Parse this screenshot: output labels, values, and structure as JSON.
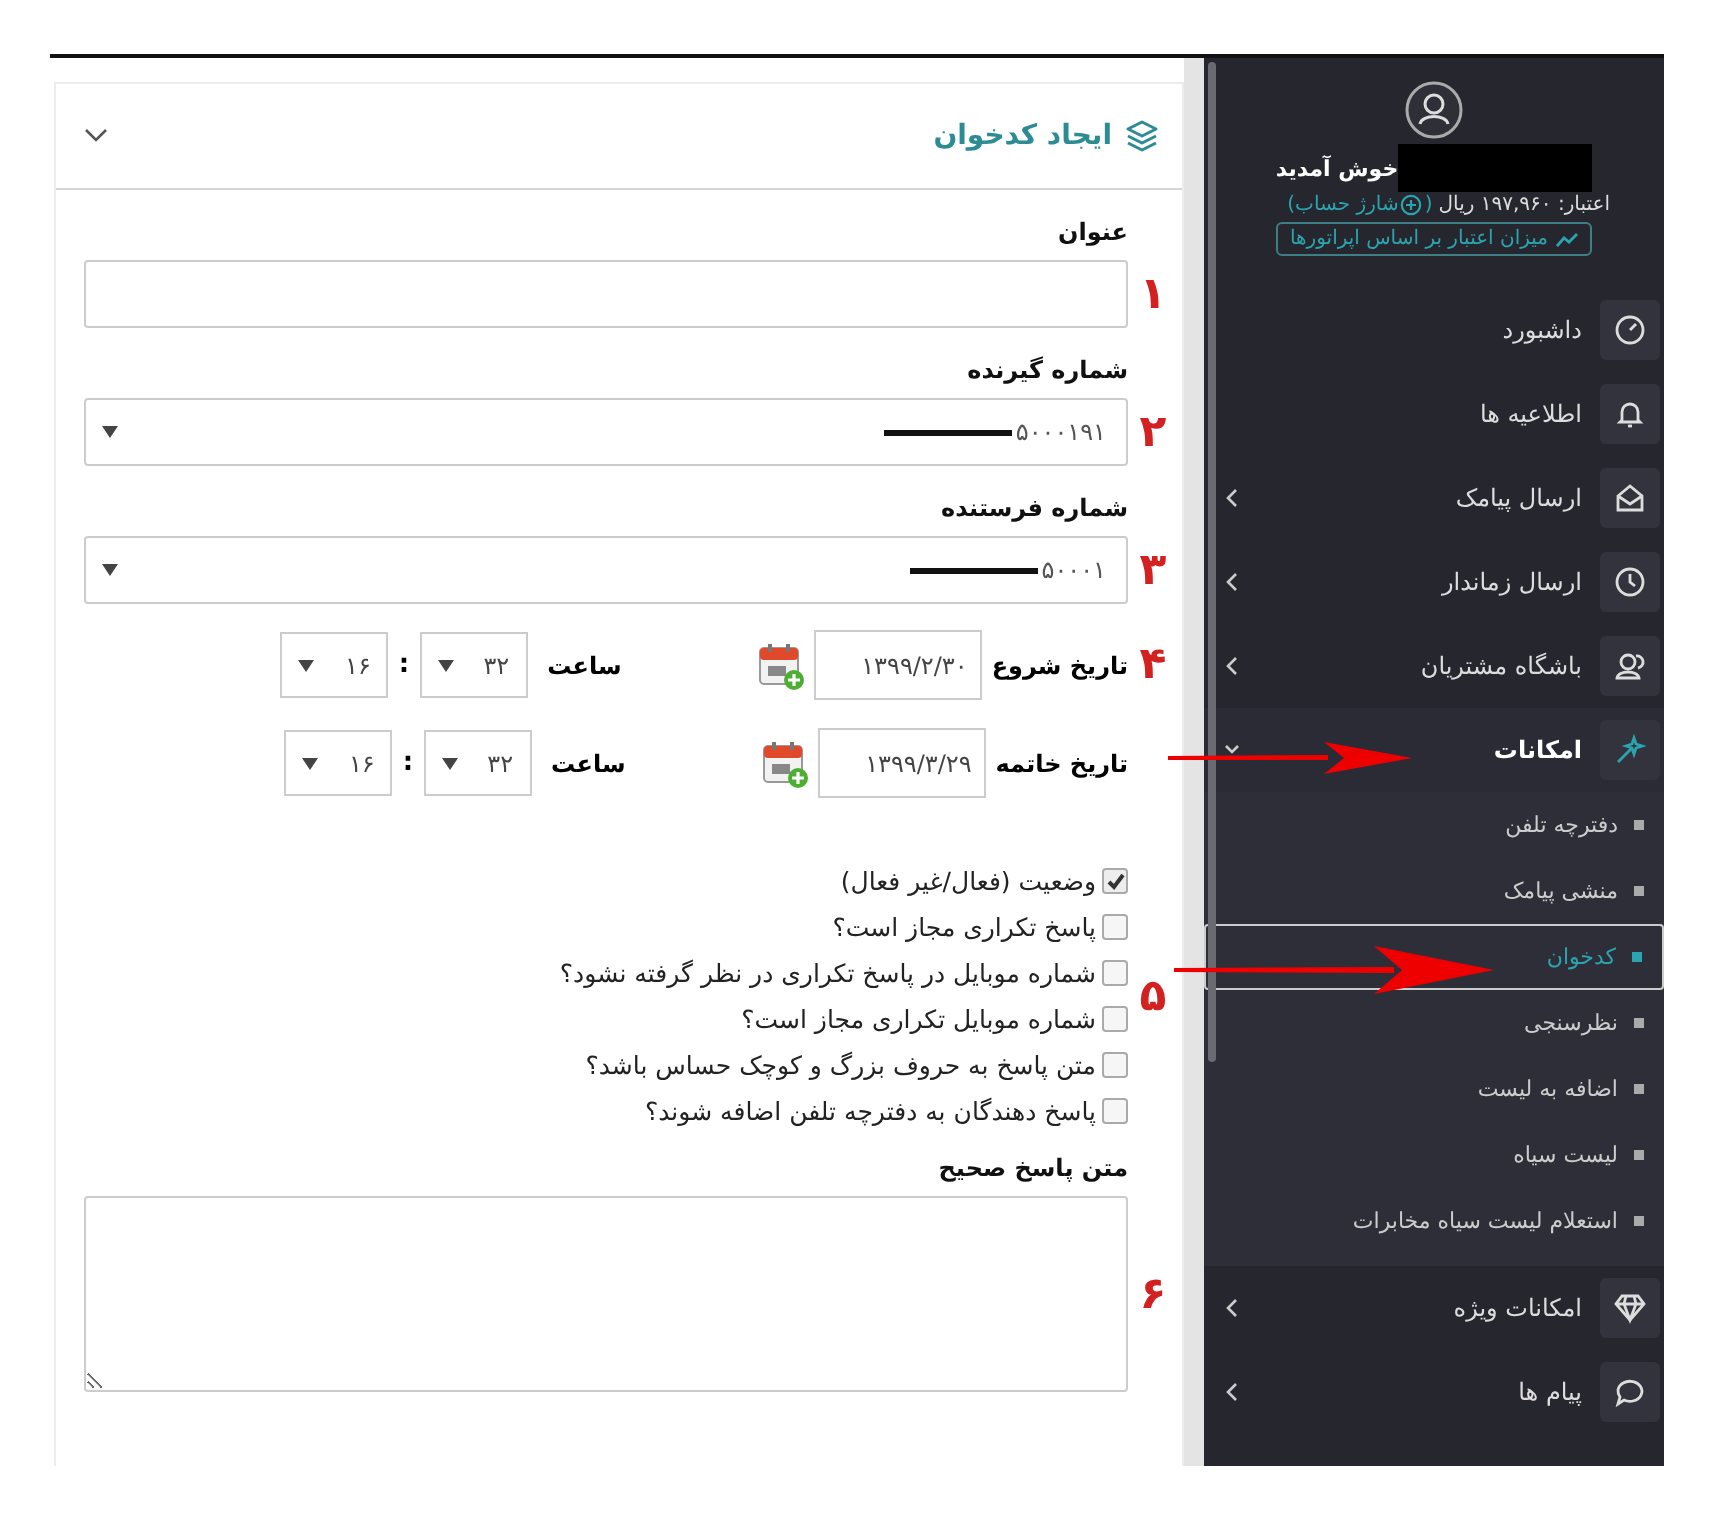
{
  "card": {
    "title": "ایجاد کدخوان"
  },
  "fields": [
    {
      "kind": "text",
      "label": "عنوان",
      "marker": "۱"
    },
    {
      "kind": "select",
      "label": "شماره گیرنده",
      "value": "۵۰۰۰۱۹۱",
      "marker": "۲"
    },
    {
      "kind": "select",
      "label": "شماره فرستنده",
      "value": "۵۰۰۰۱",
      "marker": "۳"
    }
  ],
  "dates": [
    {
      "label": "تاریخ شروع",
      "value": "۱۳۹۹/۲/۳۰",
      "time_label": "ساعت",
      "time_1": "۳۲",
      "separator": ":",
      "time_2": "۱۶",
      "marker": "۴"
    },
    {
      "label": "تاریخ خاتمه",
      "value": "۱۳۹۹/۳/۲۹",
      "time_label": "ساعت",
      "time_1": "۳۲",
      "separator": ":",
      "time_2": "۱۶"
    }
  ],
  "options": {
    "marker": "۵",
    "items": [
      {
        "label": "وضعیت (فعال/غیر فعال)",
        "checked": true
      },
      {
        "label": "پاسخ تکراری مجاز است؟",
        "checked": false
      },
      {
        "label": "شماره موبایل در پاسخ تکراری در نظر گرفته نشود؟",
        "checked": false
      },
      {
        "label": "شماره موبایل تکراری مجاز است؟",
        "checked": false
      },
      {
        "label": "متن پاسخ به حروف بزرگ و کوچک حساس باشد؟",
        "checked": false
      },
      {
        "label": "پاسخ دهندگان به دفترچه تلفن اضافه شوند؟",
        "checked": false
      }
    ]
  },
  "answer": {
    "label": "متن پاسخ صحیح",
    "marker": "۶"
  },
  "sidebar": {
    "welcome": "خوش آمدید",
    "credit": "اعتبار: ۱۹۷,۹۶۰ ریال",
    "charge_link": {
      "prefix": "(",
      "label": "شارژ حساب)"
    },
    "operator_button": "میزان اعتبار بر اساس اپراتورها",
    "menu": [
      {
        "label": "داشبورد",
        "has_children": false,
        "expanded": false
      },
      {
        "label": "اطلاعیه ها",
        "has_children": false,
        "expanded": false
      },
      {
        "label": "ارسال پیامک",
        "has_children": true,
        "expanded": false
      },
      {
        "label": "ارسال زماندار",
        "has_children": true,
        "expanded": false
      },
      {
        "label": "باشگاه مشتریان",
        "has_children": true,
        "expanded": false
      },
      {
        "label": "امکانات",
        "has_children": true,
        "expanded": true,
        "children": [
          {
            "label": "دفترچه تلفن",
            "selected": false
          },
          {
            "label": "منشی پیامک",
            "selected": false
          },
          {
            "label": "کدخوان",
            "selected": true
          },
          {
            "label": "نظرسنجی",
            "selected": false
          },
          {
            "label": "اضافه به لیست",
            "selected": false
          },
          {
            "label": "لیست سیاه",
            "selected": false
          },
          {
            "label": "استعلام لیست سیاه مخابرات",
            "selected": false
          }
        ]
      },
      {
        "label": "امکانات ویژه",
        "has_children": true,
        "expanded": false
      },
      {
        "label": "پیام ها",
        "has_children": true,
        "expanded": false
      }
    ]
  }
}
